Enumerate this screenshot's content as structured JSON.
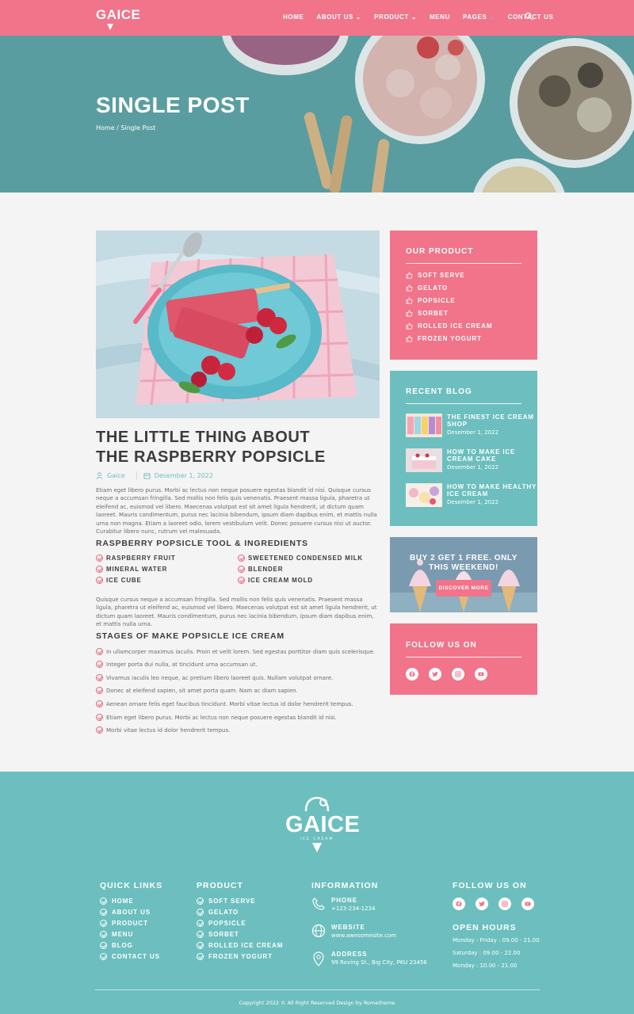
{
  "brand": {
    "name": "GAICE",
    "tagline": "ICE CREAM"
  },
  "nav": {
    "items": [
      {
        "label": "HOME",
        "caret": false,
        "active": false
      },
      {
        "label": "ABOUT US",
        "caret": true,
        "active": false
      },
      {
        "label": "PRODUCT",
        "caret": true,
        "active": false
      },
      {
        "label": "MENU",
        "caret": false,
        "active": false
      },
      {
        "label": "PAGES",
        "caret": true,
        "active": true
      },
      {
        "label": "CONTACT US",
        "caret": false,
        "active": false
      }
    ]
  },
  "hero": {
    "title": "SINGLE POST",
    "breadcrumb": "Home / Single Post"
  },
  "post": {
    "title": "THE LITTLE THING ABOUT THE RASPBERRY POPSICLE",
    "author": "Gaice",
    "date": "Desember 1, 2022",
    "intro": "Etiam eget libero purus. Morbi ac lectus non neque posuere egestas blandit id nisi. Quisque cursus neque a accumsan fringilla. Sed mollis non felis quis venenatis. Praesent massa ligula, pharetra ut eleifend ac, euismod vel libero. Maecenas volutpat est sit amet ligula hendrerit, ut dictum quam laoreet. Mauris condimentum, purus nec lacinia bibendum, ipsum diam dapibus enim, et mattis nulla urna non magna. Etiam a laoreet odio, lorem vestibulum velit. Donec posuere cursus nisi ut auctor. Curabitur libero nunc, rutrum vel malesuada.",
    "ingredients_heading": "RASPBERRY POPSICLE TOOL & INGREDIENTS",
    "ingredients_left": [
      "RASPBERRY FRUIT",
      "MINERAL WATER",
      "ICE CUBE"
    ],
    "ingredients_right": [
      "SWEETENED CONDENSED MILK",
      "BLENDER",
      "ICE CREAM MOLD"
    ],
    "body2": "Quisque cursus neque a accumsan fringilla. Sed mollis non felis quis venenatis. Praesent massa ligula, pharetra ut eleifend ac, euismod vel libero. Maecenas volutpat est sit amet ligula hendrerit, ut dictum quam laoreet. Mauris condimentum, purus nec lacinia bibendum, ipsum diam dapibus enim, et mattis nulla urna.",
    "stages_heading": "STAGES OF MAKE POPSICLE ICE CREAM",
    "stages": [
      "In ullamcorper maximus iaculis. Proin et velit lorem. Sed egestas porttitor diam quis scelerisque.",
      "Integer porta dui nulla, at tincidunt urna accumsan ut.",
      "Vivamus iaculis leo neque, ac pretium libero laoreet quis. Nullam volutpat ornare.",
      "Donec at eleifend sapien, sit amet porta quam. Nam ac diam sapien.",
      "Aenean ornare felis eget faucibus tincidunt. Morbi vitae lectus id dolor hendrerit tempus.",
      "Etiam eget libero purus. Morbi ac lectus non neque posuere egestas blandit id nisi.",
      "Morbi vitae lectus id dolor hendrerit tempus."
    ]
  },
  "sidebar": {
    "product": {
      "title": "OUR PRODUCT",
      "items": [
        "SOFT SERVE",
        "GELATO",
        "POPSICLE",
        "SORBET",
        "ROLLED ICE CREAM",
        "FROZEN YOGURT"
      ]
    },
    "blog": {
      "title": "RECENT BLOG",
      "items": [
        {
          "title": "THE FINEST ICE CREAM SHOP",
          "date": "Desember 1, 2022"
        },
        {
          "title": "HOW TO MAKE ICE CREAM CAKE",
          "date": "Desember 1, 2022"
        },
        {
          "title": "HOW TO MAKE HEALTHY ICE CREAM",
          "date": "Desember 1, 2022"
        }
      ]
    },
    "promo": {
      "title": "BUY 2 GET 1 FREE. ONLY THIS WEEKEND!",
      "button": "DISCOVER MORE"
    },
    "follow": {
      "title": "FOLLOW US ON",
      "icons": [
        "facebook-icon",
        "twitter-icon",
        "instagram-icon",
        "youtube-icon"
      ]
    }
  },
  "footer": {
    "quick": {
      "title": "QUICK LINKS",
      "items": [
        "HOME",
        "ABOUT US",
        "PRODUCT",
        "MENU",
        "BLOG",
        "CONTACT US"
      ]
    },
    "product": {
      "title": "PRODUCT",
      "items": [
        "SOFT SERVE",
        "GELATO",
        "POPSICLE",
        "SORBET",
        "ROLLED ICE CREAM",
        "FROZEN YOGURT"
      ]
    },
    "info": {
      "title": "INFORMATION",
      "phone_label": "PHONE",
      "phone": "+123-234-1234",
      "website_label": "WEBSITE",
      "website": "www.awesomesite.com",
      "address_label": "ADDRESS",
      "address": "99 Roving St., Big City, PKU 23456"
    },
    "follow": {
      "title": "FOLLOW US ON"
    },
    "hours": {
      "title": "OPEN HOURS",
      "items": [
        "Monday - Friday : 09.00 - 21.00",
        "Saturday : 09.00 - 22.00",
        "Monday : 10.00 - 21.00"
      ]
    },
    "copyright": "Copyright 2022 © All Right Reserved Design by Rometheme"
  },
  "colors": {
    "pink": "#f1748a",
    "teal": "#6cbfbe",
    "heading": "#3c3c3c"
  }
}
